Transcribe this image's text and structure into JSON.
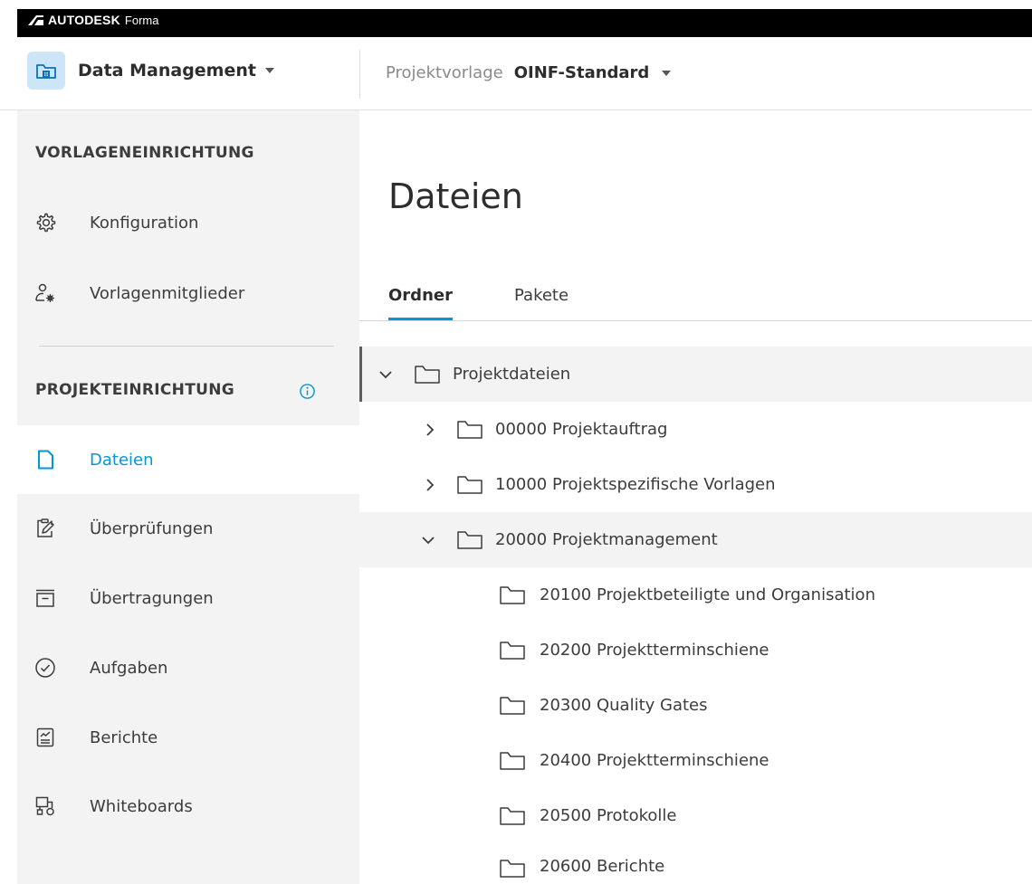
{
  "brand": {
    "name": "AUTODESK",
    "product": "Forma"
  },
  "header": {
    "app_name": "Data Management",
    "template_label": "Projektvorlage",
    "template_value": "OINF-Standard"
  },
  "sidebar": {
    "section_template": "VORLAGENEINRICHTUNG",
    "template_items": [
      {
        "label": "Konfiguration",
        "icon": "gear-icon"
      },
      {
        "label": "Vorlagenmitglieder",
        "icon": "member-settings-icon"
      }
    ],
    "section_project": "PROJEKTEINRICHTUNG",
    "project_items": [
      {
        "label": "Dateien",
        "icon": "file-icon",
        "active": true
      },
      {
        "label": "Überprüfungen",
        "icon": "review-icon"
      },
      {
        "label": "Übertragungen",
        "icon": "transmittal-icon"
      },
      {
        "label": "Aufgaben",
        "icon": "check-circle-icon"
      },
      {
        "label": "Berichte",
        "icon": "report-icon"
      },
      {
        "label": "Whiteboards",
        "icon": "whiteboard-icon"
      }
    ]
  },
  "main": {
    "title": "Dateien",
    "tabs": [
      {
        "label": "Ordner",
        "active": true
      },
      {
        "label": "Pakete",
        "active": false
      }
    ],
    "tree": [
      {
        "label": "Projektdateien",
        "level": 0,
        "expanded": true
      },
      {
        "label": "00000 Projektauftrag",
        "level": 1,
        "expanded": false
      },
      {
        "label": "10000 Projektspezifische Vorlagen",
        "level": 1,
        "expanded": false
      },
      {
        "label": "20000 Projektmanagement",
        "level": 1,
        "expanded": true
      },
      {
        "label": "20100 Projektbeteiligte und Organisation",
        "level": 2
      },
      {
        "label": "20200 Projektterminschiene",
        "level": 2
      },
      {
        "label": "20300 Quality Gates",
        "level": 2
      },
      {
        "label": "20400 Projektterminschiene",
        "level": 2
      },
      {
        "label": "20500 Protokolle",
        "level": 2
      },
      {
        "label": "20600 Berichte",
        "level": 2
      }
    ]
  },
  "colors": {
    "accent": "#0696d7",
    "sidebar_bg": "#f3f3f3",
    "brand_bar": "#000000"
  }
}
